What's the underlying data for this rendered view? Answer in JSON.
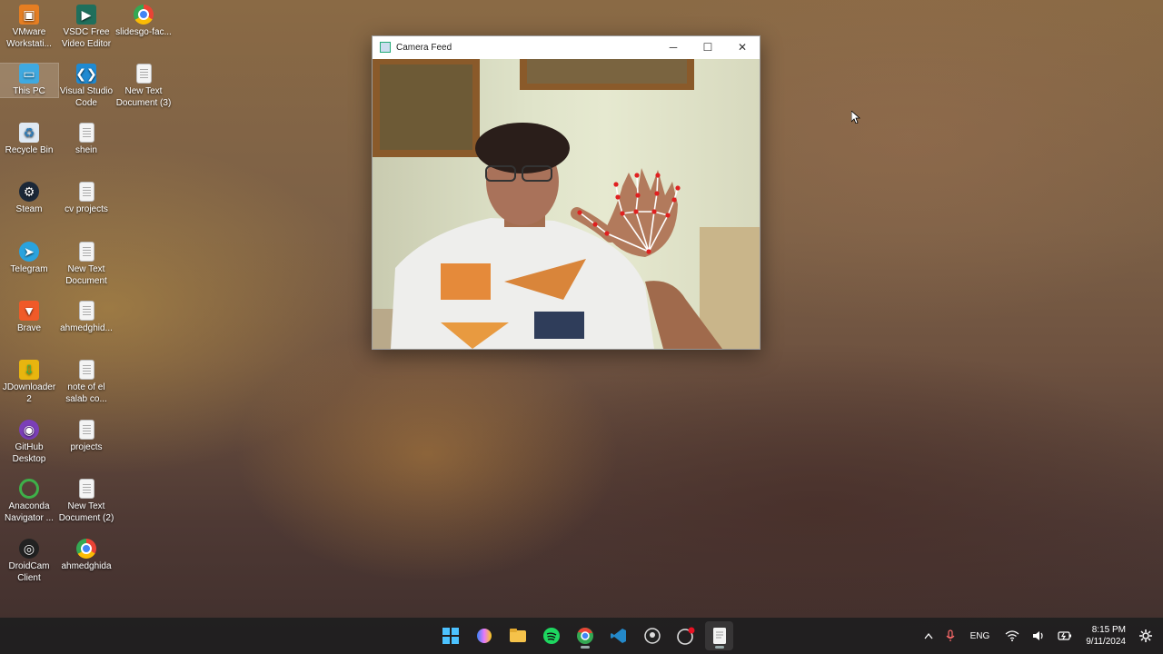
{
  "desktop": {
    "icons": [
      {
        "label": "VMware Workstati..."
      },
      {
        "label": "VSDC Free Video Editor"
      },
      {
        "label": "slidesgo-fac..."
      },
      {
        "label": "This PC"
      },
      {
        "label": "Visual Studio Code"
      },
      {
        "label": "New Text Document (3)"
      },
      {
        "label": "Recycle Bin"
      },
      {
        "label": "shein"
      },
      {
        "label": "Steam"
      },
      {
        "label": "cv projects"
      },
      {
        "label": "Telegram"
      },
      {
        "label": "New Text Document"
      },
      {
        "label": "Brave"
      },
      {
        "label": "ahmedghid..."
      },
      {
        "label": "JDownloader 2"
      },
      {
        "label": "note of el salab co..."
      },
      {
        "label": "GitHub Desktop"
      },
      {
        "label": "projects"
      },
      {
        "label": "Anaconda Navigator ..."
      },
      {
        "label": "New Text Document (2)"
      },
      {
        "label": "DroidCam Client"
      },
      {
        "label": "ahmedghida"
      }
    ]
  },
  "window": {
    "title": "Camera Feed",
    "minimize": "─",
    "maximize": "☐",
    "close": "✕"
  },
  "taskbar": {
    "apps": [
      "start-icon",
      "copilot-icon",
      "file-explorer-icon",
      "spotify-icon",
      "chrome-icon",
      "vscode-icon",
      "droidcam-icon",
      "github-icon",
      "notepad-icon"
    ],
    "tray": {
      "language": "ENG",
      "time": "8:15 PM",
      "date": "9/11/2024"
    }
  },
  "colors": {
    "landmark": "#e02020",
    "connection": "#ffffff",
    "taskbar": "#1e1e20"
  }
}
